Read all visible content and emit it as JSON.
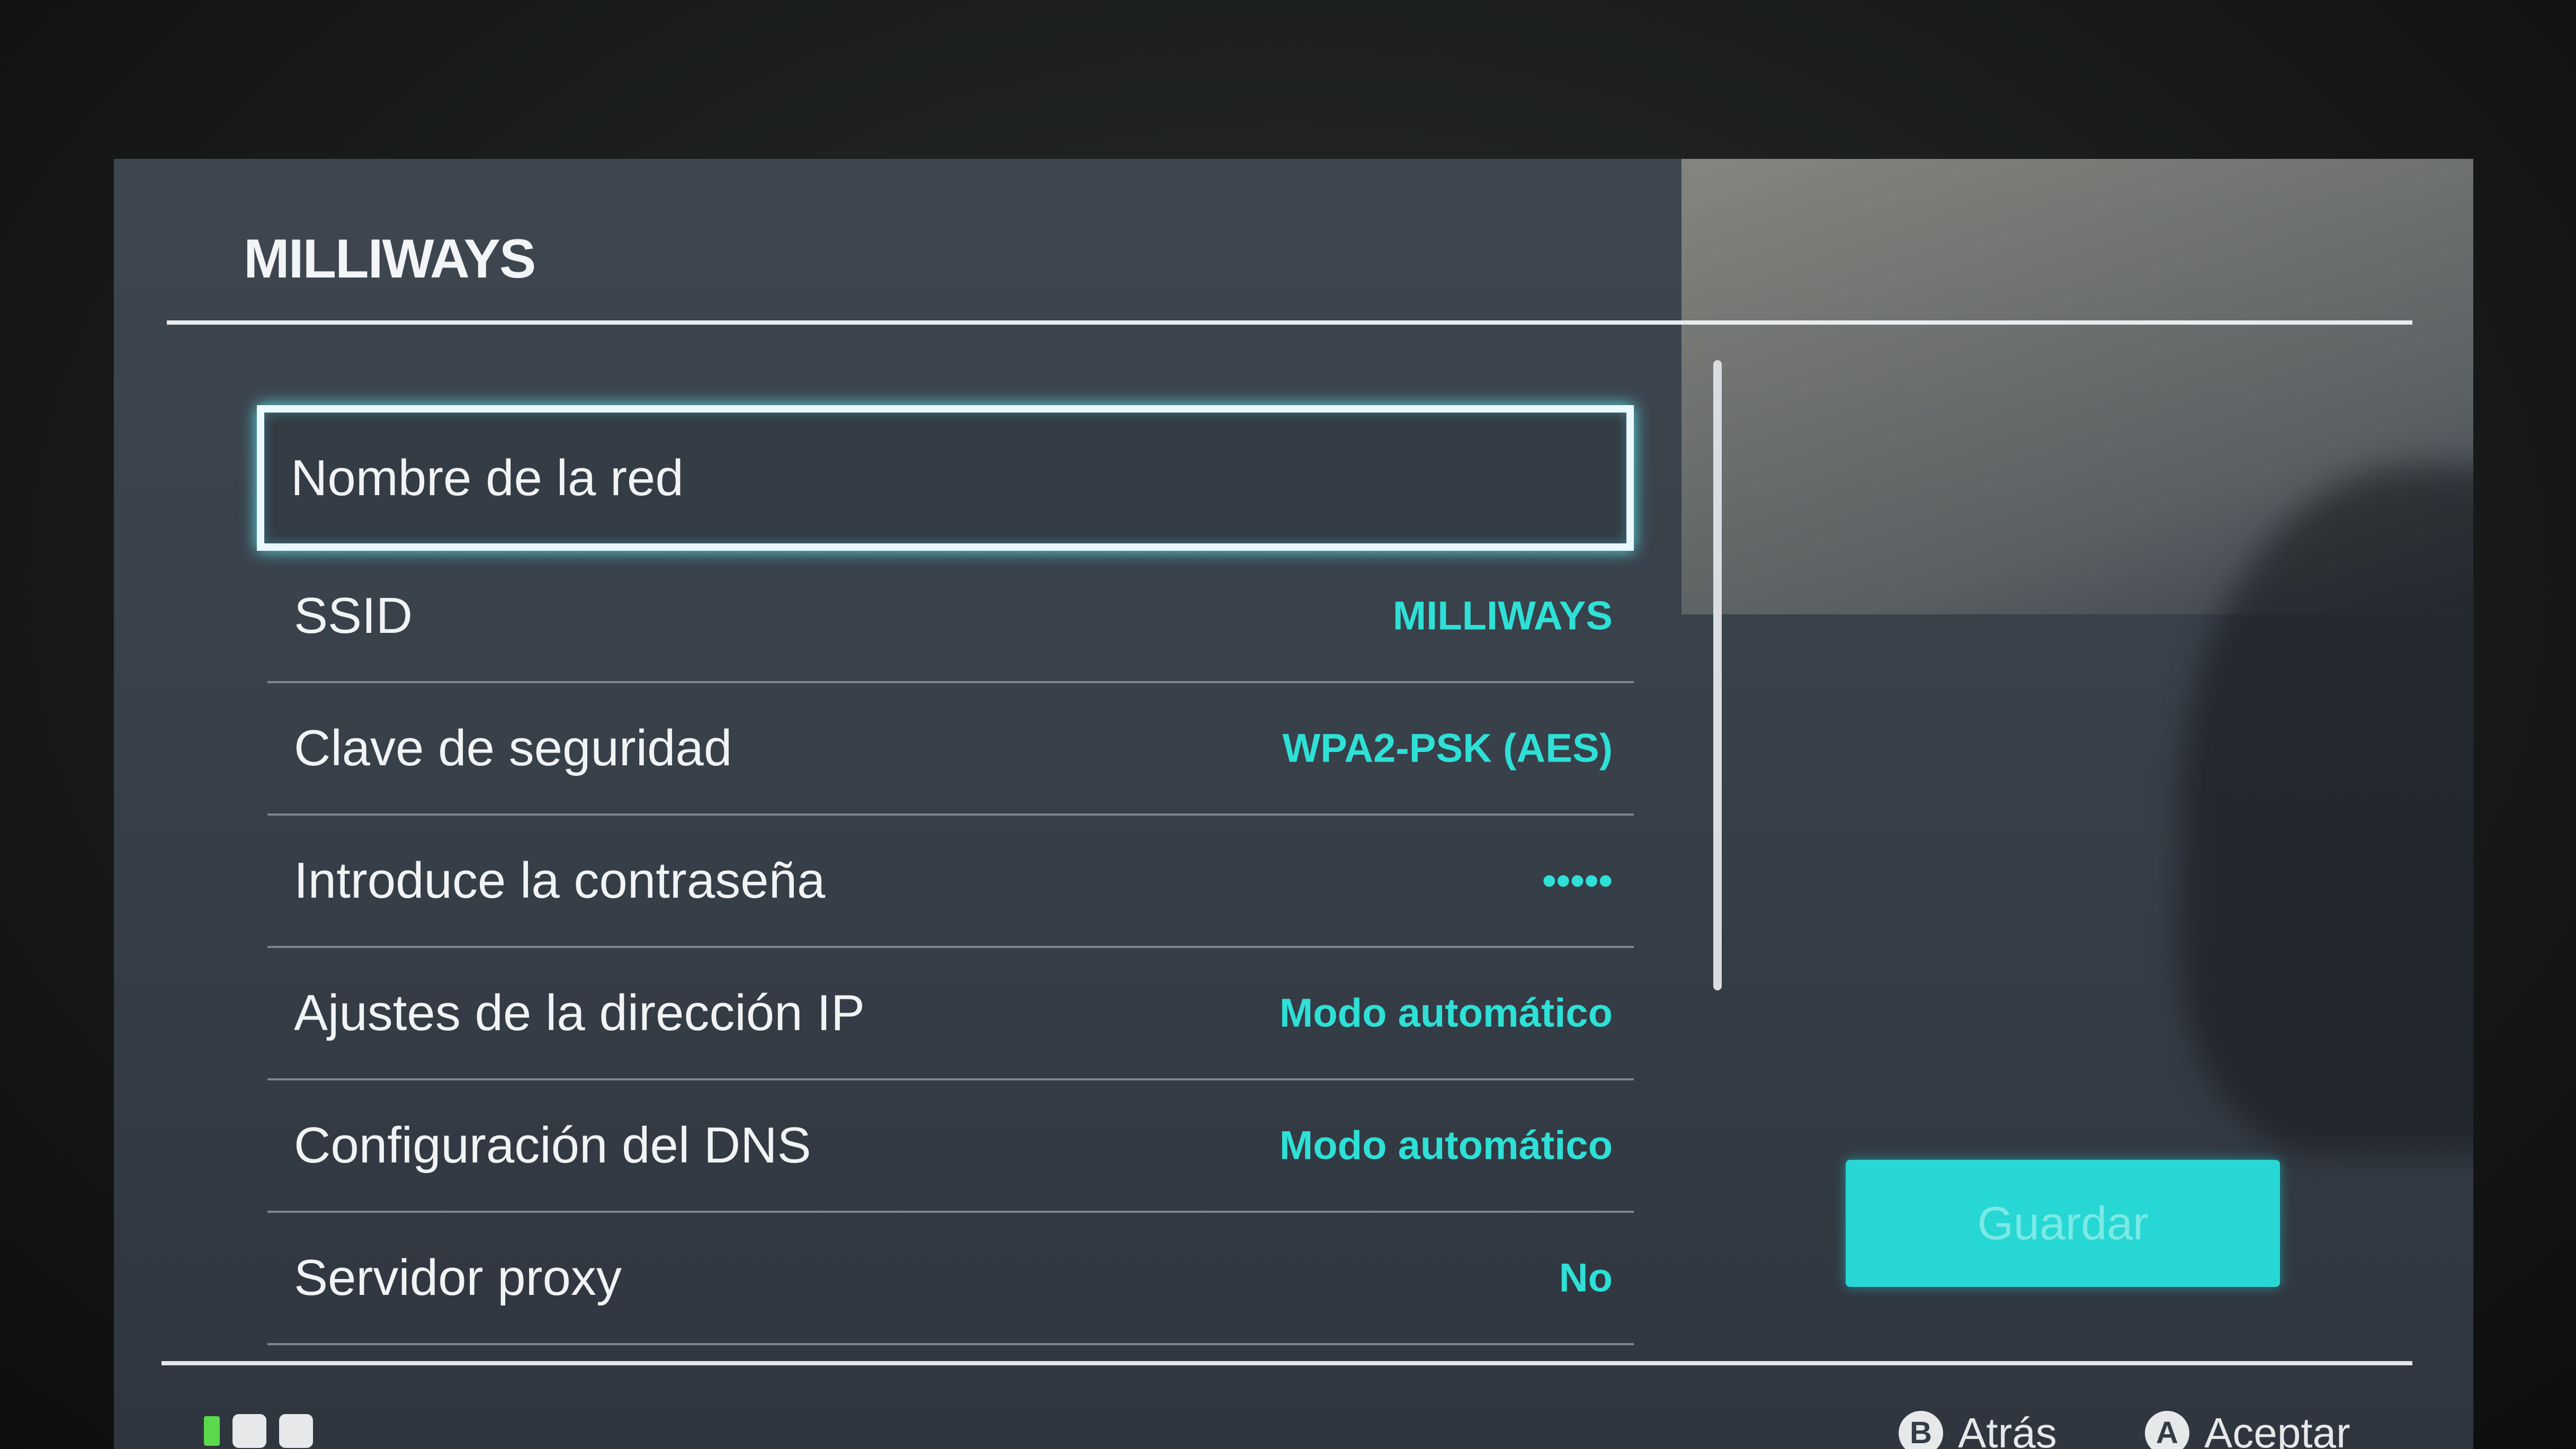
{
  "header": {
    "title": "MILLIWAYS"
  },
  "settings": {
    "rows": [
      {
        "label": "Nombre de la red",
        "value": ""
      },
      {
        "label": "SSID",
        "value": "MILLIWAYS"
      },
      {
        "label": "Clave de seguridad",
        "value": "WPA2-PSK (AES)"
      },
      {
        "label": "Introduce la contraseña",
        "value": "•••••"
      },
      {
        "label": "Ajustes de la dirección IP",
        "value": "Modo automático"
      },
      {
        "label": "Configuración del DNS",
        "value": "Modo automático"
      },
      {
        "label": "Servidor proxy",
        "value": "No"
      }
    ],
    "selected_index": 0
  },
  "actions": {
    "save_label": "Guardar"
  },
  "footer": {
    "back_glyph": "B",
    "back_label": "Atrás",
    "accept_glyph": "A",
    "accept_label": "Aceptar"
  },
  "colors": {
    "accent": "#2ee0d6",
    "button": "#27d7d3",
    "selection_border": "#eaf8ff",
    "background": "#38404a"
  }
}
